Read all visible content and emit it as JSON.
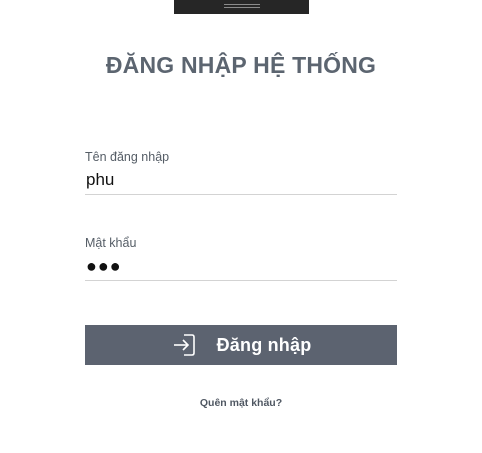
{
  "header": {
    "title": "ĐĂNG NHẬP HỆ THỐNG"
  },
  "form": {
    "username": {
      "label": "Tên đăng nhập",
      "value": "phu"
    },
    "password": {
      "label": "Mật khẩu",
      "value": "●●●"
    },
    "submit_label": "Đăng nhập",
    "submit_icon": "login-icon",
    "forgot_label": "Quên mật khẩu?"
  },
  "colors": {
    "title": "#5c6570",
    "button_bg": "#5c6370",
    "button_text": "#ffffff",
    "topbar": "#262626"
  }
}
